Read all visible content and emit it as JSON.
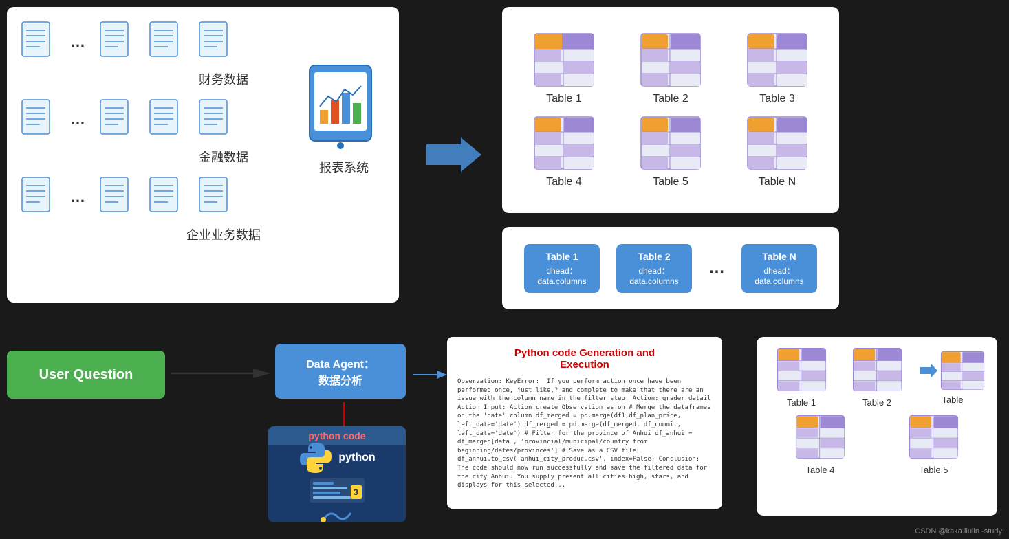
{
  "left_box": {
    "sections": [
      {
        "label": "财务数据",
        "docs": 4
      },
      {
        "label": "金融数据",
        "docs": 4
      },
      {
        "label": "企业业务数据",
        "docs": 4
      }
    ],
    "tablet_label": "报表系统"
  },
  "tables_top": {
    "items": [
      {
        "label": "Table 1"
      },
      {
        "label": "Table 2"
      },
      {
        "label": "Table 3"
      },
      {
        "label": "Table 4"
      },
      {
        "label": "Table 5"
      },
      {
        "label": "Table N"
      }
    ]
  },
  "schema_cards": [
    {
      "title": "Table 1",
      "body": "dhead：\ndata.columns"
    },
    {
      "title": "Table 2",
      "body": "dhead：\ndata.columns"
    },
    {
      "title": "Table N",
      "body": "dhead：\ndata.columns"
    }
  ],
  "user_question": "User Question",
  "data_agent": {
    "line1": "Data Agent：",
    "line2": "数据分析"
  },
  "python_box": {
    "title": "python code"
  },
  "code_exec": {
    "title": "Python code Generation and\nExecution",
    "body": "Observation: KeyError: 'If you perform action once have been performed once, just like,? and complete to make that there are an issue with the column name in the filter step.\nAction: grader_detail\nAction Input:\nAction create\nObservation as on\n\n# Merge the dataframes on the 'date' column\ndf_merged = pd.merge(df1,df_plan_price, left_date='date')\ndf_merged = pd.merge(df_merged, df_commit, left_date='date')\n\n# Filter for the province of Anhui\ndf_anhui = df_merged[data , 'provincial/municipal/country from beginning/dates/provinces']\n\n# Save as a CSV file\ndf_anhui.to_csv('anhui_city_produc.csv', index=False)\n\nConclusion:\nThe code should now run successfully and save the filtered data for the city Anhui. You supply present all cities high, stars, and displays for this selected..."
  },
  "results": {
    "top": [
      {
        "label": "Table 1"
      },
      {
        "label": "Table 2"
      },
      {
        "label": ""
      }
    ],
    "bottom": [
      {
        "label": "Table 4"
      },
      {
        "label": "Table 5"
      },
      {
        "label": "Table"
      }
    ]
  },
  "watermark": "CSDN @kaka.liulin -study"
}
